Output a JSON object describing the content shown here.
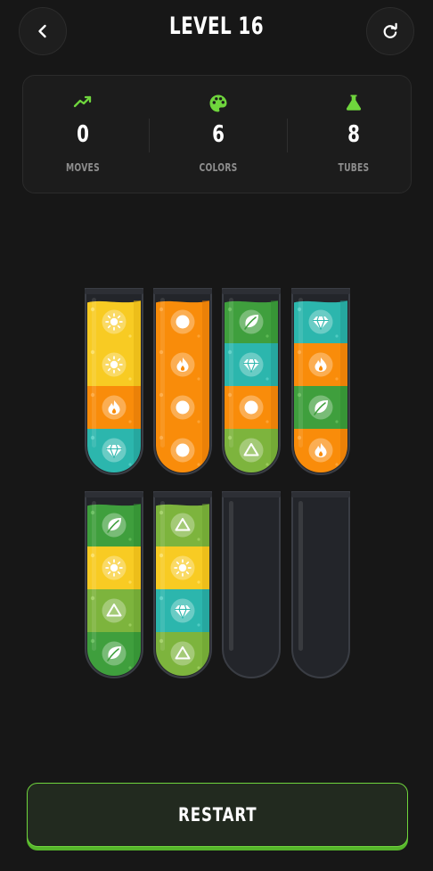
{
  "header": {
    "title": "LEVEL 16",
    "back_icon": "chevron-left-icon",
    "restart_icon": "refresh-icon"
  },
  "stats": {
    "moves": {
      "value": "0",
      "label": "MOVES",
      "icon": "trending-up-icon"
    },
    "colors": {
      "value": "6",
      "label": "COLORS",
      "icon": "palette-icon"
    },
    "tubes": {
      "value": "8",
      "label": "TUBES",
      "icon": "flask-icon"
    }
  },
  "accent_color": "#6fd53d",
  "palette": {
    "yellow": {
      "fill": "#f8cb23",
      "light": "#fde36f",
      "dark": "#e0b010"
    },
    "orange": {
      "fill": "#f98c0a",
      "light": "#ffad46",
      "dark": "#d97306"
    },
    "teal": {
      "fill": "#2cb6ad",
      "light": "#5fd4cb",
      "dark": "#1f958d"
    },
    "green": {
      "fill": "#3f9f3d",
      "light": "#6cc460",
      "dark": "#2f8a2e"
    },
    "lime": {
      "fill": "#7db43d",
      "light": "#a6d468",
      "dark": "#6a9e2e"
    }
  },
  "tubes": [
    {
      "id": 1,
      "layers": [
        {
          "color": "yellow",
          "icon": "sun"
        },
        {
          "color": "yellow",
          "icon": "sun"
        },
        {
          "color": "orange",
          "icon": "flame"
        },
        {
          "color": "teal",
          "icon": "diamond"
        }
      ]
    },
    {
      "id": 2,
      "layers": [
        {
          "color": "orange",
          "icon": "circle"
        },
        {
          "color": "orange",
          "icon": "flame"
        },
        {
          "color": "orange",
          "icon": "circle"
        },
        {
          "color": "orange",
          "icon": "circle"
        }
      ]
    },
    {
      "id": 3,
      "layers": [
        {
          "color": "green",
          "icon": "leaf"
        },
        {
          "color": "teal",
          "icon": "diamond"
        },
        {
          "color": "orange",
          "icon": "circle"
        },
        {
          "color": "lime",
          "icon": "triangle"
        }
      ]
    },
    {
      "id": 4,
      "layers": [
        {
          "color": "teal",
          "icon": "diamond"
        },
        {
          "color": "orange",
          "icon": "flame"
        },
        {
          "color": "green",
          "icon": "leaf"
        },
        {
          "color": "orange",
          "icon": "flame"
        }
      ]
    },
    {
      "id": 5,
      "layers": [
        {
          "color": "green",
          "icon": "leaf"
        },
        {
          "color": "yellow",
          "icon": "sun"
        },
        {
          "color": "lime",
          "icon": "triangle"
        },
        {
          "color": "green",
          "icon": "leaf"
        }
      ]
    },
    {
      "id": 6,
      "layers": [
        {
          "color": "lime",
          "icon": "triangle"
        },
        {
          "color": "yellow",
          "icon": "sun"
        },
        {
          "color": "teal",
          "icon": "diamond"
        },
        {
          "color": "lime",
          "icon": "triangle"
        }
      ]
    },
    {
      "id": 7,
      "layers": []
    },
    {
      "id": 8,
      "layers": []
    }
  ],
  "footer": {
    "restart_label": "RESTART"
  }
}
